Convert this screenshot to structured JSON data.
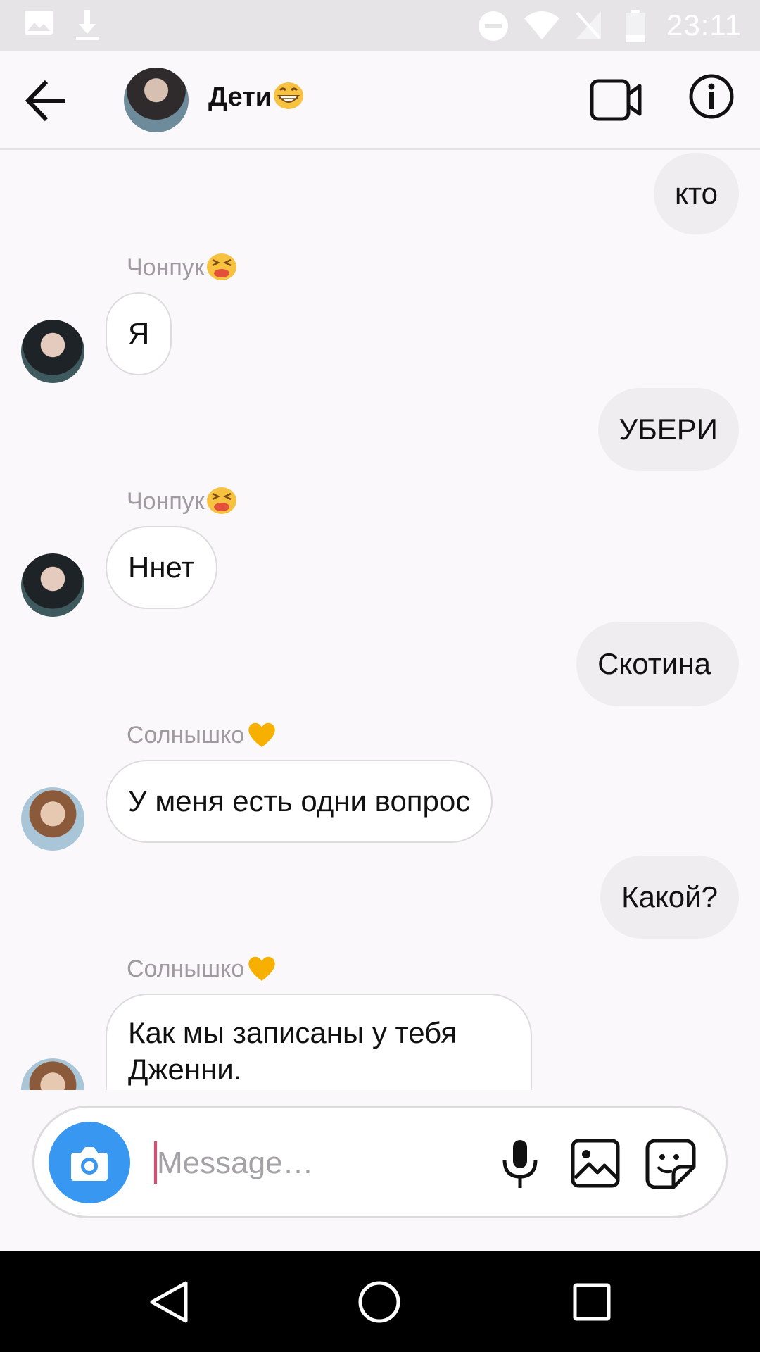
{
  "status_bar": {
    "time": "23:11"
  },
  "header": {
    "title": "Дети",
    "title_emoji": "grinning-face"
  },
  "messages": [
    {
      "dir": "out",
      "text": "кто"
    },
    {
      "dir": "in",
      "sender": "Чонпук",
      "sender_emoji": "persevering-face",
      "text": "Я"
    },
    {
      "dir": "out",
      "text": "УБЕРИ"
    },
    {
      "dir": "in",
      "sender": "Чонпук",
      "sender_emoji": "persevering-face",
      "text": "Ннет"
    },
    {
      "dir": "out",
      "text": "Скотина"
    },
    {
      "dir": "in",
      "sender": "Солнышко",
      "sender_emoji": "yellow-heart",
      "text": "У меня есть одни вопрос"
    },
    {
      "dir": "out",
      "text": "Какой?"
    },
    {
      "dir": "in",
      "sender": "Солнышко",
      "sender_emoji": "yellow-heart",
      "text": "Как мы записаны у тебя Дженни."
    }
  ],
  "composer": {
    "placeholder": "Message…",
    "value": ""
  },
  "colors": {
    "accent": "#3897f0",
    "outgoing_bubble": "#efedef",
    "caret": "#e8466b"
  }
}
